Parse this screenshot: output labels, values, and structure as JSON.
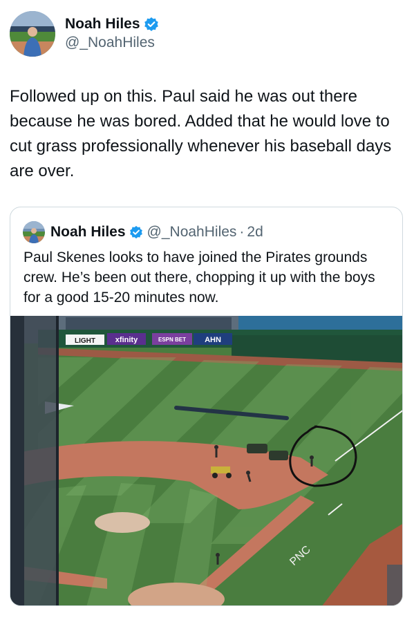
{
  "author": {
    "display_name": "Noah Hiles",
    "handle": "@_NoahHiles",
    "verified": true,
    "avatar_icon": "profile-photo"
  },
  "tweet": {
    "text": "Followed up on this. Paul said he was out there because he was bored. Added that he would love to cut grass professionally whenever his baseball days are over."
  },
  "quoted_tweet": {
    "display_name": "Noah Hiles",
    "handle": "@_NoahHiles",
    "separator": "·",
    "time": "2d",
    "verified": true,
    "text": "Paul Skenes looks to have joined the Pirates grounds crew. He’s been out there, chopping it up with the boys for a good 15-20 minutes now.",
    "photo": {
      "signage": [
        "LIGHT",
        "xfinity",
        "ESPN BET",
        "AHN"
      ],
      "field_text": "PNC"
    }
  },
  "colors": {
    "verified_blue": "#1d9bf0",
    "text_primary": "#0f1419",
    "text_secondary": "#536471",
    "border": "#cfd9de"
  }
}
